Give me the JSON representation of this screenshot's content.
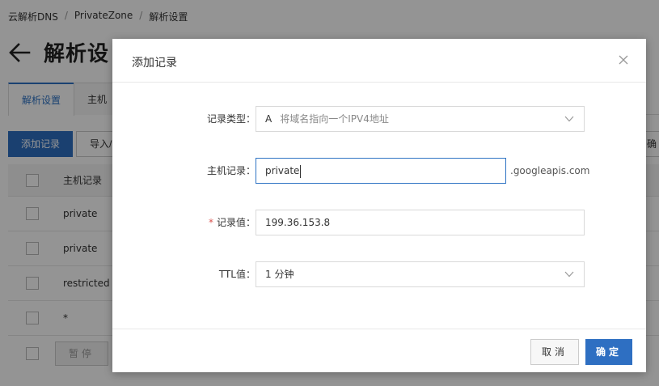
{
  "breadcrumb": [
    "云解析DNS",
    "PrivateZone",
    "解析设置"
  ],
  "page": {
    "title": "解析设",
    "tabs": [
      "解析设置",
      "主机"
    ],
    "toolbar": {
      "add_label": "添加记录",
      "import_label": "导入/",
      "right_label": "确"
    },
    "table": {
      "header": "主机记录",
      "rows": [
        "private",
        "private",
        "restricted",
        "*"
      ],
      "pause_label": "暂停"
    }
  },
  "modal": {
    "title": "添加记录",
    "fields": {
      "record_type": {
        "label": "记录类型：",
        "value": "A",
        "hint": "将域名指向一个IPV4地址"
      },
      "host": {
        "label": "主机记录：",
        "value": "private",
        "suffix": ".googleapis.com"
      },
      "record_value": {
        "required_mark": "*",
        "label": "记录值：",
        "value": "199.36.153.8"
      },
      "ttl": {
        "label": "TTL值：",
        "value": "1 分钟"
      }
    },
    "cancel_label": "取消",
    "confirm_label": "确定"
  },
  "colors": {
    "primary": "#2e6fc2",
    "required": "#d9534f",
    "mask": "rgba(0,0,0,0.42)"
  }
}
